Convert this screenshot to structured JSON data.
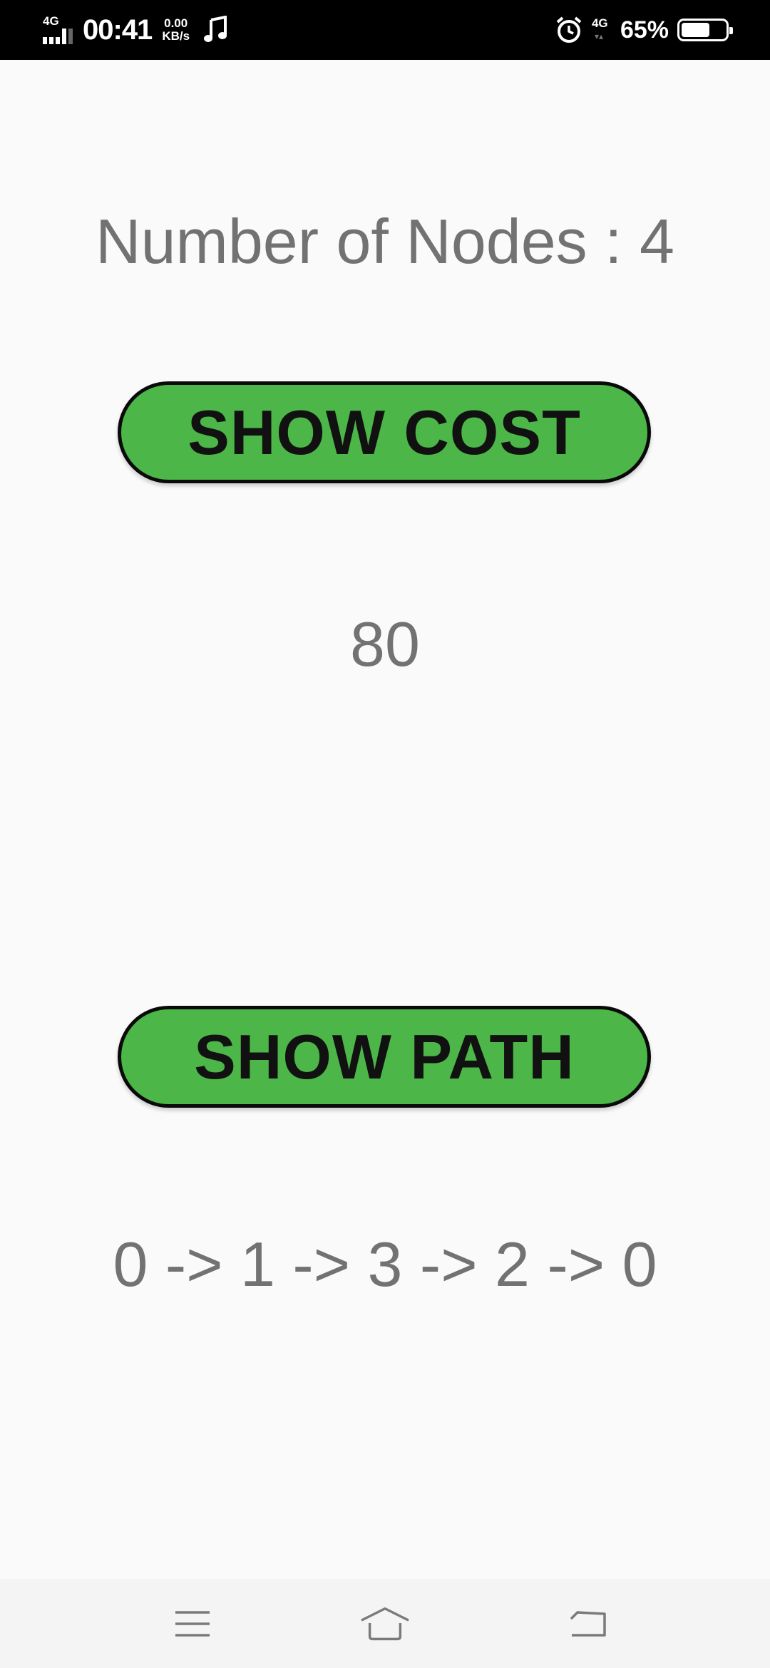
{
  "status_bar": {
    "network_left": "4G",
    "time": "00:41",
    "speed_value": "0.00",
    "speed_unit": "KB/s",
    "network_right": "4G",
    "battery_percent": "65%",
    "battery_level": 0.65
  },
  "main": {
    "nodes_label": "Number of Nodes : 4",
    "show_cost_label": "SHOW COST",
    "cost_value": "80",
    "show_path_label": "SHOW PATH",
    "path_value": "0 -> 1 -> 3 -> 2 -> 0"
  },
  "colors": {
    "button_green": "#4cb648",
    "text_gray": "#727272",
    "background": "#fafafa"
  },
  "nav_bar": {
    "icons": [
      "menu-icon",
      "home-icon",
      "back-icon"
    ]
  }
}
